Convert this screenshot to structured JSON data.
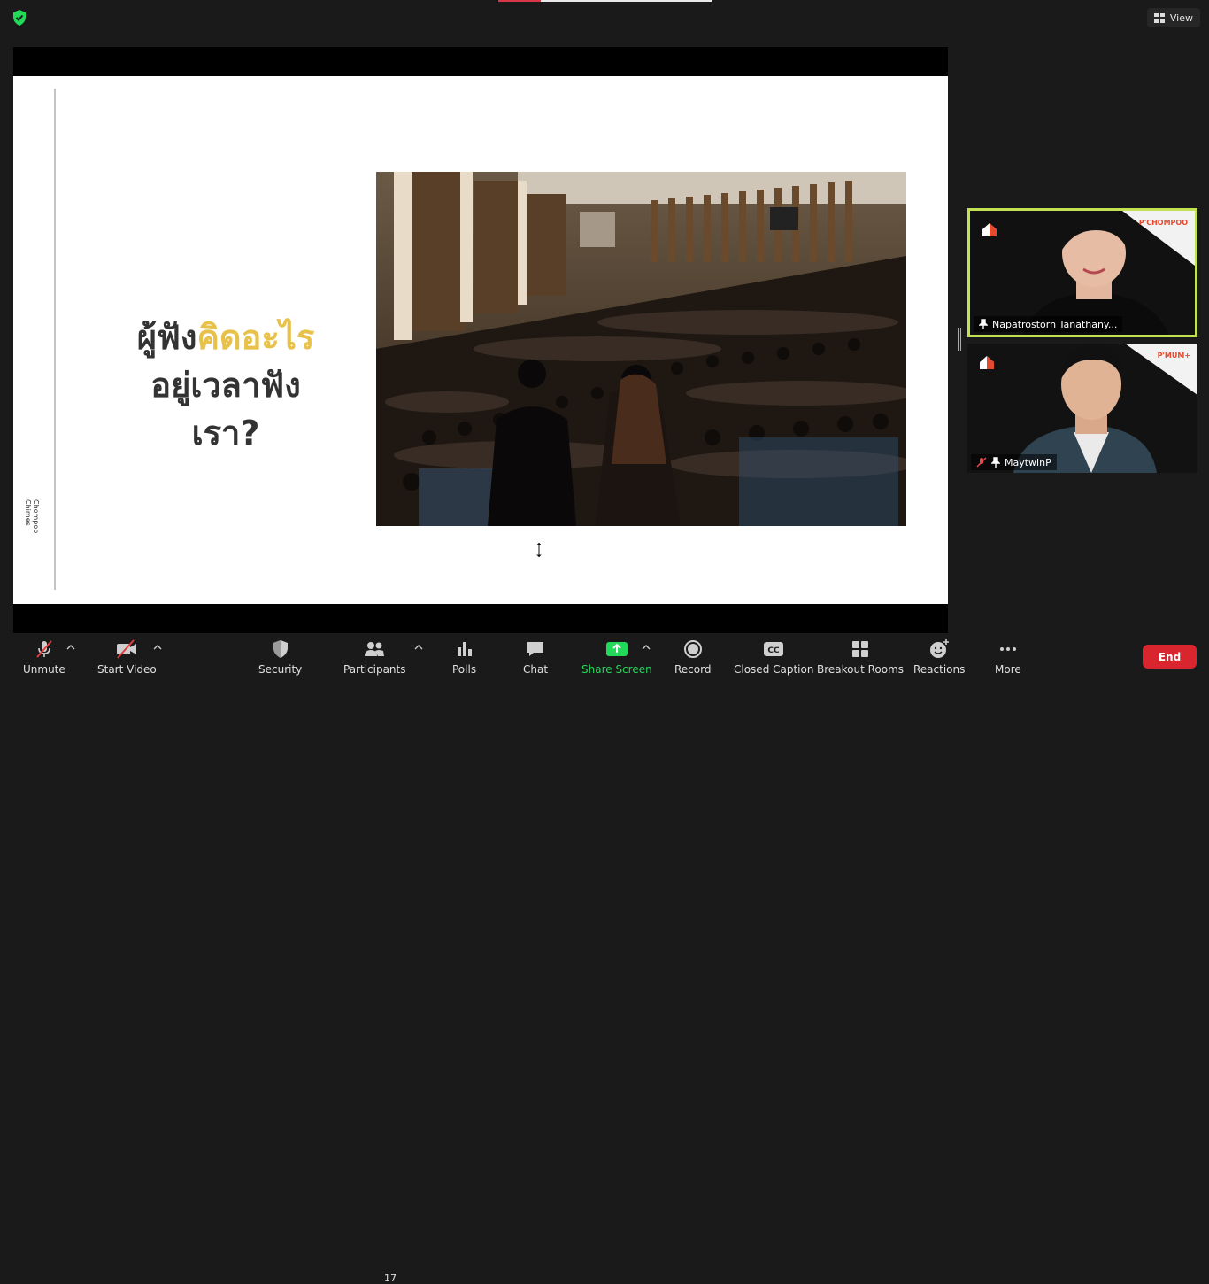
{
  "top": {
    "view_label": "View"
  },
  "slide": {
    "author_text": "Chompoo Chimes",
    "headline_part1": "ผู้ฟัง",
    "headline_part2": "คิดอะไร",
    "headline_line2": "อยู่เวลาฟัง",
    "headline_line3": "เรา?",
    "colors": {
      "highlight": "#e7c14a",
      "text": "#333333"
    }
  },
  "participants_panel": [
    {
      "name": "Napatrostorn Tanathany...",
      "brand": "P'CHOMPOO",
      "active_speaker": true
    },
    {
      "name": "MaytwinP",
      "brand": "P'MUM+",
      "muted": true
    }
  ],
  "toolbar": {
    "unmute": "Unmute",
    "start_video": "Start Video",
    "security": "Security",
    "participants": "Participants",
    "participants_count": "17",
    "polls": "Polls",
    "chat": "Chat",
    "share_screen": "Share Screen",
    "record": "Record",
    "closed_caption": "Closed Caption",
    "breakout_rooms": "Breakout Rooms",
    "reactions": "Reactions",
    "more": "More",
    "end": "End"
  },
  "colors": {
    "share_green": "#23d959",
    "end_red": "#d9252e",
    "active_border": "#c2e155"
  }
}
